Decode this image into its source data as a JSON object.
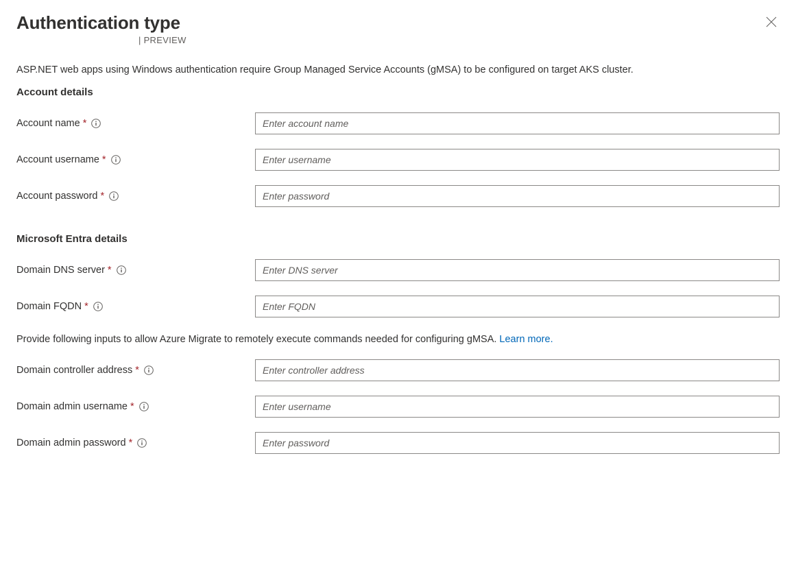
{
  "header": {
    "title": "Authentication type",
    "preview": "| PREVIEW"
  },
  "description": "ASP.NET web apps using Windows authentication require Group Managed Service Accounts (gMSA) to be configured on target AKS cluster.",
  "sections": {
    "account": {
      "title": "Account details",
      "fields": {
        "name": {
          "label": "Account name",
          "placeholder": "Enter account name",
          "value": ""
        },
        "username": {
          "label": "Account username",
          "placeholder": "Enter username",
          "value": ""
        },
        "password": {
          "label": "Account password",
          "placeholder": "Enter password",
          "value": ""
        }
      }
    },
    "entra": {
      "title": "Microsoft Entra details",
      "fields": {
        "dns": {
          "label": "Domain DNS server",
          "placeholder": "Enter DNS server",
          "value": ""
        },
        "fqdn": {
          "label": "Domain FQDN",
          "placeholder": "Enter FQDN",
          "value": ""
        }
      },
      "helper": {
        "text": "Provide following inputs to allow Azure Migrate to remotely execute commands needed for configuring gMSA. ",
        "link": "Learn more."
      },
      "fields2": {
        "controller": {
          "label": "Domain controller address",
          "placeholder": "Enter controller address",
          "value": ""
        },
        "admin_user": {
          "label": "Domain admin username",
          "placeholder": "Enter username",
          "value": ""
        },
        "admin_password": {
          "label": "Domain admin password",
          "placeholder": "Enter password",
          "value": ""
        }
      }
    }
  }
}
